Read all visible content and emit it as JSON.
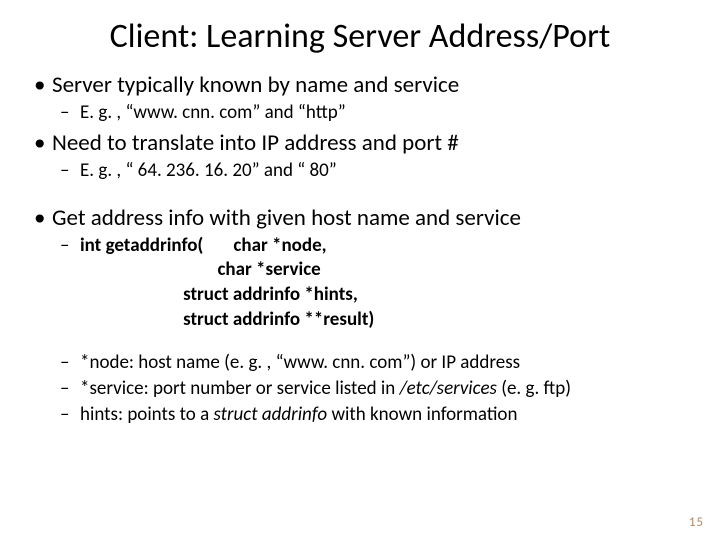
{
  "title": "Client: Learning Server Address/Port",
  "b1": "Server typically known by name and service",
  "b1s1": "E. g. , “www. cnn. com” and “http”",
  "b2": "Need to translate into IP address and port #",
  "b2s1": "E. g. , “ 64. 236. 16. 20” and “ 80”",
  "b3": "Get address info with given host name and service",
  "sig_lead": "int getaddrinfo(       ",
  "sig_l1": "char *node,",
  "sig_l2": "                                char *service",
  "sig_l3": "                        struct addrinfo *hints,",
  "sig_l4": "                        struct addrinfo **result)",
  "b3s2a": "*node: host name (e. g. , ",
  "b3s2b": "“www. cnn. com”",
  "b3s2c": ") or IP address",
  "b3s3a": "*service: port number or service listed in ",
  "b3s3b": "/etc/services",
  "b3s3c": " (e. g. ftp)",
  "b3s4a": "hints: points to a  ",
  "b3s4b": "struct addrinfo",
  "b3s4c": " with known information",
  "pagenum": "15"
}
